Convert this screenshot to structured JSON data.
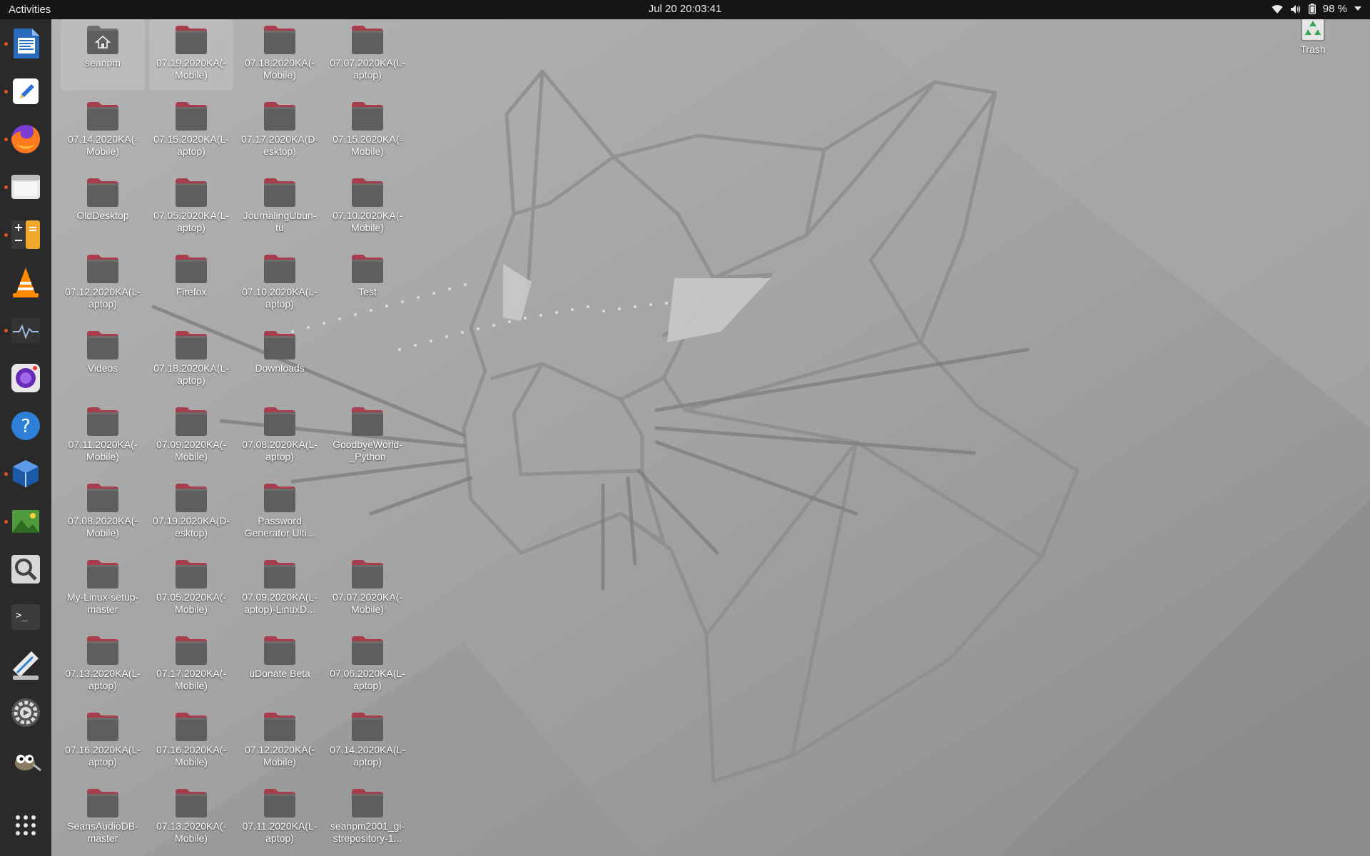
{
  "topbar": {
    "activities": "Activities",
    "clock": "Jul 20  20:03:41",
    "battery": "98 %"
  },
  "dock": {
    "items": [
      {
        "name": "libreoffice-writer-icon",
        "running": true
      },
      {
        "name": "text-editor-icon",
        "running": true
      },
      {
        "name": "firefox-icon",
        "running": true
      },
      {
        "name": "files-icon",
        "running": true
      },
      {
        "name": "calculator-icon",
        "running": true
      },
      {
        "name": "vlc-icon",
        "running": false
      },
      {
        "name": "system-monitor-icon",
        "running": true
      },
      {
        "name": "cheese-webcam-icon",
        "running": false
      },
      {
        "name": "help-icon",
        "running": false
      },
      {
        "name": "virtualbox-icon",
        "running": true
      },
      {
        "name": "image-viewer-icon",
        "running": true
      },
      {
        "name": "search-tool-icon",
        "running": false
      },
      {
        "name": "terminal-icon",
        "running": false
      },
      {
        "name": "disk-image-icon",
        "running": false
      },
      {
        "name": "settings-icon",
        "running": false
      },
      {
        "name": "gimp-icon",
        "running": false
      },
      {
        "name": "show-applications-icon",
        "running": false
      }
    ]
  },
  "desktop": {
    "icons": [
      {
        "label": "seanpm",
        "type": "home",
        "selected": true
      },
      {
        "label": "07.19.2020KA(-Mobile)",
        "type": "folder",
        "selected": true
      },
      {
        "label": "07.18.2020KA(-Mobile)",
        "type": "folder"
      },
      {
        "label": "07.07.2020KA(L-aptop)",
        "type": "folder"
      },
      {
        "label": "07.14.2020KA(-Mobile)",
        "type": "folder"
      },
      {
        "label": "07.15.2020KA(L-aptop)",
        "type": "folder"
      },
      {
        "label": "07.17.2020KA(D-esktop)",
        "type": "folder"
      },
      {
        "label": "07.15.2020KA(-Mobile)",
        "type": "folder"
      },
      {
        "label": "OldDesktop",
        "type": "folder"
      },
      {
        "label": "07.05.2020KA(L-aptop)",
        "type": "folder"
      },
      {
        "label": "JournalingUbun-tu",
        "type": "folder"
      },
      {
        "label": "07.10.2020KA(-Mobile)",
        "type": "folder"
      },
      {
        "label": "07.12.2020KA(L-aptop)",
        "type": "folder"
      },
      {
        "label": "Firefox",
        "type": "folder"
      },
      {
        "label": "07.10.2020KA(L-aptop)",
        "type": "folder"
      },
      {
        "label": "Test",
        "type": "folder"
      },
      {
        "label": "Videos",
        "type": "folder"
      },
      {
        "label": "07.18.2020KA(L-aptop)",
        "type": "folder"
      },
      {
        "label": "Downloads",
        "type": "folder"
      },
      {
        "label": "",
        "type": "empty"
      },
      {
        "label": "07.11.2020KA(-Mobile)",
        "type": "folder"
      },
      {
        "label": "07.09.2020KA(-Mobile)",
        "type": "folder"
      },
      {
        "label": "07.08.2020KA(L-aptop)",
        "type": "folder"
      },
      {
        "label": "GoodbyeWorld-_Python",
        "type": "folder"
      },
      {
        "label": "07.08.2020KA(-Mobile)",
        "type": "folder"
      },
      {
        "label": "07.19.2020KA(D-esktop)",
        "type": "folder"
      },
      {
        "label": "Password Generator Ulti...",
        "type": "folder"
      },
      {
        "label": "",
        "type": "empty"
      },
      {
        "label": "My-Linux-setup-master",
        "type": "folder"
      },
      {
        "label": "07.05.2020KA(-Mobile)",
        "type": "folder"
      },
      {
        "label": "07.09.2020KA(L-aptop)-LinuxD...",
        "type": "folder"
      },
      {
        "label": "07.07.2020KA(-Mobile)",
        "type": "folder"
      },
      {
        "label": "07.13.2020KA(L-aptop)",
        "type": "folder"
      },
      {
        "label": "07.17.2020KA(-Mobile)",
        "type": "folder"
      },
      {
        "label": "uDonate Beta",
        "type": "folder"
      },
      {
        "label": "07.06.2020KA(L-aptop)",
        "type": "folder"
      },
      {
        "label": "07.16.2020KA(L-aptop)",
        "type": "folder"
      },
      {
        "label": "07.16.2020KA(-Mobile)",
        "type": "folder"
      },
      {
        "label": "07.12.2020KA(-Mobile)",
        "type": "folder"
      },
      {
        "label": "07.14.2020KA(L-aptop)",
        "type": "folder"
      },
      {
        "label": "SeansAudioDB-master",
        "type": "folder"
      },
      {
        "label": "07.13.2020KA(-Mobile)",
        "type": "folder"
      },
      {
        "label": "07.11.2020KA(L-aptop)",
        "type": "folder"
      },
      {
        "label": "seanpm2001_gi-strepository-1...",
        "type": "folder"
      }
    ],
    "trash_label": "Trash"
  },
  "colors": {
    "folder_body": "#5e5e5e",
    "folder_tab": "#a83d4e",
    "accent": "#e95420",
    "topbar": "#151515",
    "dock": "#2a2a2a"
  }
}
